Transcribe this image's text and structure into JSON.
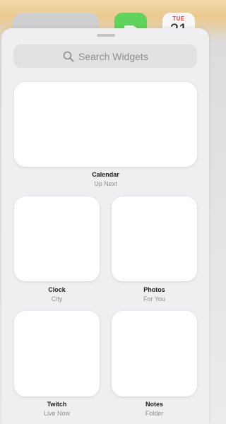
{
  "home": {
    "calendar_day": "TUE",
    "calendar_date": "21"
  },
  "search": {
    "placeholder": "Search Widgets"
  },
  "widgets": [
    {
      "title": "Calendar",
      "subtitle": "Up Next"
    },
    {
      "title": "Clock",
      "subtitle": "City"
    },
    {
      "title": "Photos",
      "subtitle": "For You"
    },
    {
      "title": "Twitch",
      "subtitle": "Live Now"
    },
    {
      "title": "Notes",
      "subtitle": "Folder"
    }
  ]
}
